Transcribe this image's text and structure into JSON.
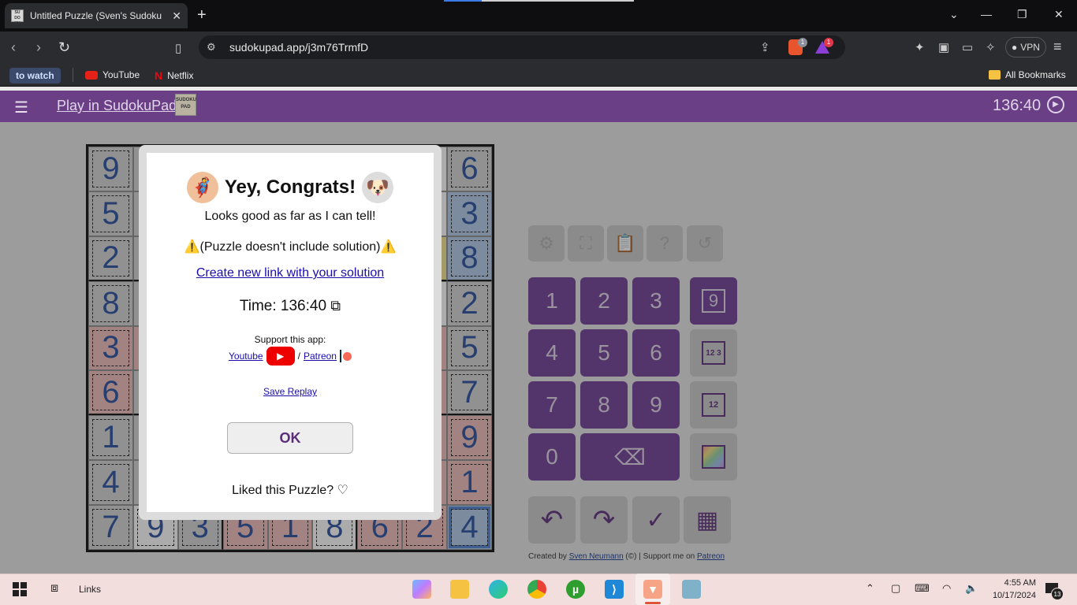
{
  "browser": {
    "tab_title": "Untitled Puzzle (Sven's Sudoku",
    "tab_close": "✕",
    "new_tab": "+",
    "url": "sudokupad.app/j3m76TrmfD",
    "vpn_label": "VPN",
    "brave_badge": "1",
    "rewards_badge": "1",
    "bookmarks": {
      "to_watch": "to watch",
      "youtube": "YouTube",
      "netflix": "Netflix",
      "all": "All Bookmarks"
    }
  },
  "app": {
    "link": "Play in SudokuPad",
    "logo_text": "SUDOKU PAD",
    "timer": "136:40",
    "credit_prefix": "Created by",
    "credit_author": "Sven Neumann",
    "credit_mid": "(©) | Support me on",
    "credit_patreon": "Patreon"
  },
  "grid": {
    "cells": [
      [
        "9",
        "",
        "",
        "",
        "",
        "",
        "",
        "",
        "6"
      ],
      [
        "5",
        "",
        "",
        "",
        "",
        "",
        "",
        "",
        "3"
      ],
      [
        "2",
        "",
        "",
        "",
        "",
        "",
        "",
        "",
        "8"
      ],
      [
        "8",
        "",
        "",
        "",
        "",
        "",
        "",
        "",
        "2"
      ],
      [
        "3",
        "",
        "",
        "",
        "",
        "",
        "",
        "",
        "5"
      ],
      [
        "6",
        "",
        "",
        "",
        "",
        "",
        "",
        "",
        "7"
      ],
      [
        "1",
        "",
        "",
        "",
        "",
        "",
        "",
        "",
        "9"
      ],
      [
        "4",
        "",
        "",
        "",
        "",
        "",
        "",
        "",
        "1"
      ],
      [
        "7",
        "9",
        "3",
        "5",
        "1",
        "8",
        "6",
        "2",
        "4"
      ]
    ],
    "colors": [
      [
        "gray",
        "gray",
        "",
        "",
        "",
        "",
        "",
        "",
        "gray"
      ],
      [
        "gray",
        "gray",
        "",
        "",
        "",
        "",
        "",
        "",
        "blue"
      ],
      [
        "gray",
        "gray",
        "",
        "",
        "",
        "",
        "",
        "yel",
        "blue"
      ],
      [
        "gray",
        "gray",
        "",
        "",
        "",
        "",
        "",
        "",
        "gray"
      ],
      [
        "red",
        "red",
        "",
        "",
        "",
        "",
        "",
        "red",
        "gray"
      ],
      [
        "red",
        "gray",
        "",
        "",
        "",
        "",
        "",
        "red",
        "gray"
      ],
      [
        "gray",
        "gray",
        "",
        "",
        "",
        "",
        "",
        "red",
        "red"
      ],
      [
        "gray",
        "gray",
        "",
        "",
        "",
        "",
        "",
        "red",
        "red"
      ],
      [
        "gray",
        "",
        "gray",
        "red",
        "red",
        "",
        "red",
        "red",
        "blue"
      ]
    ]
  },
  "keypad": {
    "digits": [
      "1",
      "2",
      "3",
      "4",
      "5",
      "6",
      "7",
      "8",
      "9",
      "0"
    ],
    "modes": [
      "9",
      "12 3",
      "12"
    ]
  },
  "dialog": {
    "title": "Yey, Congrats!",
    "message": "Looks good as far as I can tell!",
    "warning": "(Puzzle doesn't include solution)",
    "warn_icon": "⚠️",
    "create_link": "Create new link with your solution",
    "time_label": "Time: 136:40",
    "support": "Support this app:",
    "youtube": "Youtube",
    "slash": "/",
    "patreon": "Patreon",
    "save_replay": "Save Replay",
    "ok": "OK",
    "liked": "Liked this Puzzle? ♡"
  },
  "taskbar": {
    "links": "Links",
    "time": "4:55 AM",
    "date": "10/17/2024",
    "notif_count": "13"
  }
}
